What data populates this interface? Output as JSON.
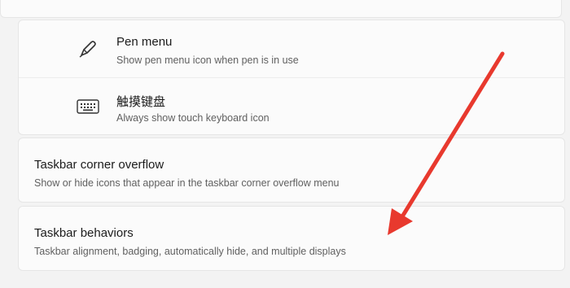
{
  "pen_menu": {
    "icon": "pen-icon",
    "title": "Pen menu",
    "description": "Show pen menu icon when pen is in use"
  },
  "touch_keyboard": {
    "icon": "keyboard-icon",
    "title": "触摸键盘",
    "description": "Always show touch keyboard icon"
  },
  "corner_overflow": {
    "title": "Taskbar corner overflow",
    "description": "Show or hide icons that appear in the taskbar corner overflow menu"
  },
  "behaviors": {
    "title": "Taskbar behaviors",
    "description": "Taskbar alignment, badging, automatically hide, and multiple displays"
  },
  "annotation": {
    "icon": "red-arrow-icon",
    "color": "#e8392e"
  }
}
